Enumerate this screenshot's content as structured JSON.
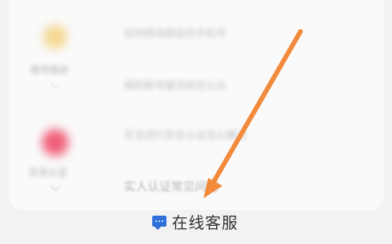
{
  "faq": {
    "categories": [
      {
        "label": "账号相关",
        "icon_color": "#f5d890"
      },
      {
        "label": "实名认证",
        "icon_color": "#f0607a"
      }
    ],
    "questions": [
      "如何修改绑定的手机号",
      "我的账号被冻结怎么办",
      "无法进行实名认证怎么解决",
      "实人认证常见问题"
    ]
  },
  "footer": {
    "customer_service_label": "在线客服",
    "icon": "chat-bubble-icon",
    "icon_color": "#2f6fd8"
  },
  "annotation": {
    "color": "#f28a3c"
  }
}
